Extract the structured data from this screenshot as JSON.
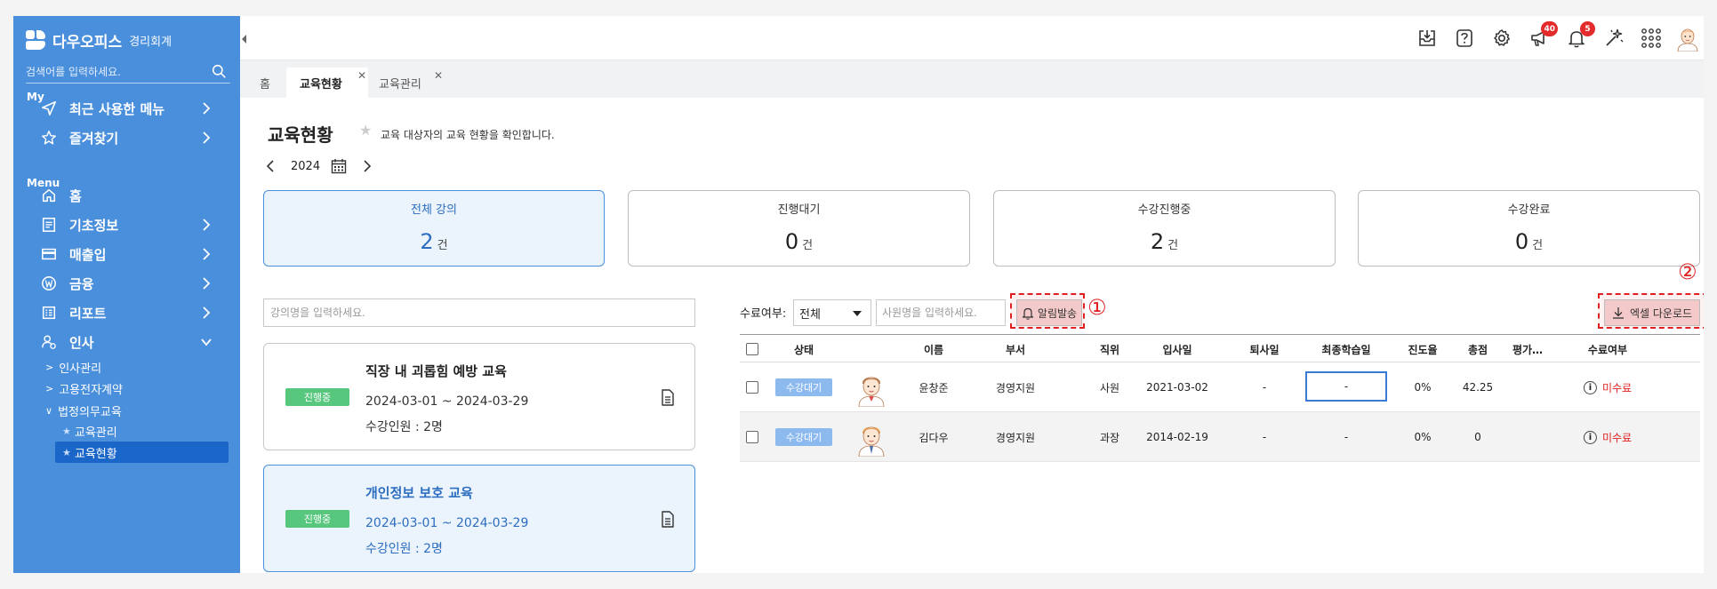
{
  "sidebar": {
    "brand": "다우오피스",
    "brand_sub": "경리회계",
    "search_placeholder": "검색어를 입력하세요.",
    "section_my": "My",
    "section_menu": "Menu",
    "my_items": [
      {
        "label": "최근 사용한 메뉴",
        "icon": "send-icon"
      },
      {
        "label": "즐겨찾기",
        "icon": "star-icon"
      }
    ],
    "menu_items": [
      {
        "label": "홈",
        "icon": "home-icon"
      },
      {
        "label": "기초정보",
        "icon": "document-icon"
      },
      {
        "label": "매출입",
        "icon": "card-icon"
      },
      {
        "label": "금융",
        "icon": "won-icon"
      },
      {
        "label": "리포트",
        "icon": "report-icon"
      },
      {
        "label": "인사",
        "icon": "people-icon"
      }
    ],
    "hr_sub": [
      "인사관리",
      "고용전자계약",
      "법정의무교육"
    ],
    "edu_leaves": [
      "교육관리",
      "교육현황"
    ]
  },
  "topbar": {
    "badges": {
      "megaphone": "40",
      "bell": "5"
    }
  },
  "tabs": [
    {
      "label": "홈"
    },
    {
      "label": "교육현황"
    },
    {
      "label": "교육관리"
    }
  ],
  "page": {
    "title": "교육현황",
    "description": "교육 대상자의 교육 현황을 확인합니다.",
    "year": "2024"
  },
  "stats": [
    {
      "label": "전체 강의",
      "value": "2",
      "unit": "건"
    },
    {
      "label": "진행대기",
      "value": "0",
      "unit": "건"
    },
    {
      "label": "수강진행중",
      "value": "2",
      "unit": "건"
    },
    {
      "label": "수강완료",
      "value": "0",
      "unit": "건"
    }
  ],
  "course_search_placeholder": "강의명을 입력하세요.",
  "courses": [
    {
      "badge": "진행중",
      "title": "직장 내 괴롭힘 예방 교육",
      "period": "2024-03-01 ~ 2024-03-29",
      "count": "수강인원 : 2명"
    },
    {
      "badge": "진행중",
      "title": "개인정보 보호 교육",
      "period": "2024-03-01 ~ 2024-03-29",
      "count": "수강인원 : 2명"
    }
  ],
  "filter": {
    "label": "수료여부:",
    "selected": "전체",
    "emp_placeholder": "사원명을 입력하세요.",
    "notify_button": "알림발송",
    "excel_button": "엑셀 다운로드",
    "marker1": "①",
    "marker2": "②"
  },
  "table": {
    "headers": [
      "상태",
      "이름",
      "부서",
      "직위",
      "입사일",
      "퇴사일",
      "최종학습일",
      "진도율",
      "총점",
      "평가…",
      "수료여부"
    ],
    "rows": [
      {
        "status": "수강대기",
        "name": "윤창준",
        "dept": "경영지원",
        "position": "사원",
        "hire_date": "2021-03-02",
        "leave_date": "-",
        "last_study": "-",
        "progress": "0%",
        "score": "42.25",
        "evaluation": "",
        "completion": "미수료"
      },
      {
        "status": "수강대기",
        "name": "김다우",
        "dept": "경영지원",
        "position": "과장",
        "hire_date": "2014-02-19",
        "leave_date": "-",
        "last_study": "-",
        "progress": "0%",
        "score": "0",
        "evaluation": "",
        "completion": "미수료"
      }
    ]
  }
}
